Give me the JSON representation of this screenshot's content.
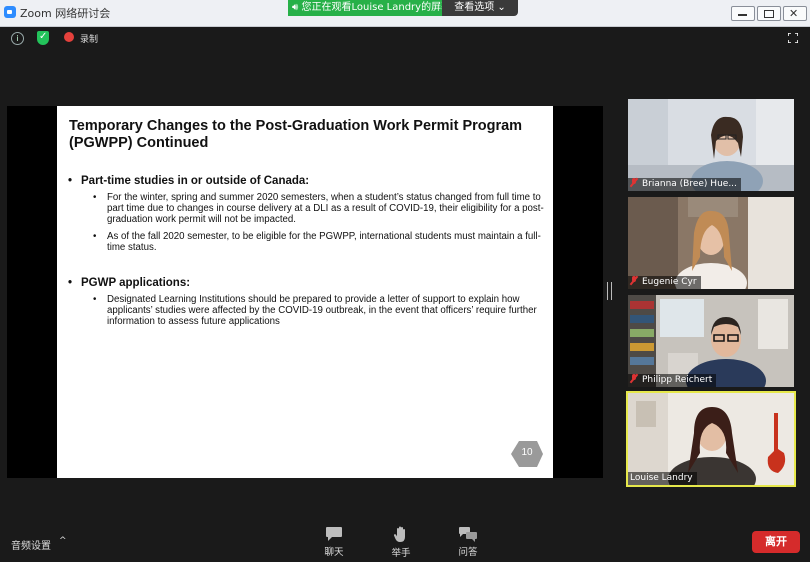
{
  "window": {
    "title": "Zoom 网络研讨会"
  },
  "share_banner": {
    "status": "您正在观看Louise  Landry的屏幕",
    "options_label": "查看选项"
  },
  "top_toolbar": {
    "info_icon": "info-icon",
    "security_icon": "shield-icon",
    "record_label": "录制",
    "fullscreen_icon": "fullscreen-icon"
  },
  "slide": {
    "title": "Temporary Changes to the Post-Graduation Work Permit Program (PGWPP) Continued",
    "sections": [
      {
        "heading": "Part-time studies in or outside of Canada:",
        "bullets": [
          "For the winter, spring and summer 2020 semesters, when a student’s status changed from full time to part time due to changes in course delivery at a DLI as a result of COVID-19, their eligibility for a post-graduation work permit will not be impacted.",
          "As of the fall 2020 semester, to be eligible for the PGWPP, international students must maintain a full-time status."
        ]
      },
      {
        "heading": "PGWP applications:",
        "bullets": [
          "Designated Learning Institutions should be prepared to provide a letter of support to explain how applicants’ studies were affected by the COVID-19 outbreak, in the event that officers’ require further information to assess future applications"
        ]
      }
    ],
    "page_number": "10"
  },
  "participants": [
    {
      "name": "Brianna (Bree) Hue...",
      "muted": true,
      "active": false
    },
    {
      "name": "Eugenie Cyr",
      "muted": true,
      "active": false
    },
    {
      "name": "Philipp Reichert",
      "muted": true,
      "active": false
    },
    {
      "name": "Louise Landry",
      "muted": false,
      "active": true
    }
  ],
  "bottom_toolbar": {
    "audio_settings_label": "音频设置",
    "chat_label": "聊天",
    "raise_hand_label": "举手",
    "qa_label": "问答",
    "leave_label": "离开"
  },
  "colors": {
    "share_green": "#27b048",
    "leave_red": "#d52b2b",
    "active_speaker": "#e6e84b",
    "zoom_blue": "#2d8cff"
  }
}
